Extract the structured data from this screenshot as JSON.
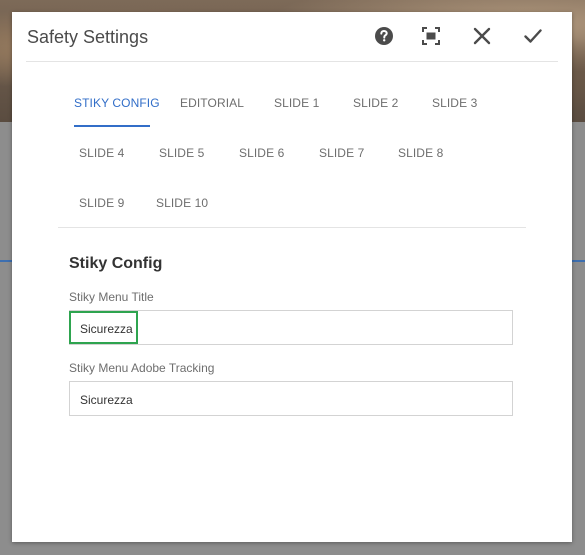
{
  "dialog": {
    "title": "Safety Settings",
    "actions": {
      "help_icon": "question-circle-icon",
      "fullscreen_icon": "fullscreen-icon",
      "close_icon": "close-icon",
      "confirm_icon": "check-icon"
    }
  },
  "tabs": [
    {
      "label": "STIKY CONFIG",
      "active": true
    },
    {
      "label": "EDITORIAL"
    },
    {
      "label": "SLIDE 1"
    },
    {
      "label": "SLIDE 2"
    },
    {
      "label": "SLIDE 3"
    },
    {
      "label": "SLIDE 4"
    },
    {
      "label": "SLIDE 5"
    },
    {
      "label": "SLIDE 6"
    },
    {
      "label": "SLIDE 7"
    },
    {
      "label": "SLIDE 8"
    },
    {
      "label": "SLIDE 9"
    },
    {
      "label": "SLIDE 10"
    }
  ],
  "section": {
    "title": "Stiky Config",
    "fields": [
      {
        "label": "Stiky Menu Title",
        "value": "Sicurezza"
      },
      {
        "label": "Stiky Menu Adobe Tracking",
        "value": "Sicurezza"
      }
    ]
  },
  "colors": {
    "accent": "#326ec8",
    "highlight": "#2ea44f"
  }
}
